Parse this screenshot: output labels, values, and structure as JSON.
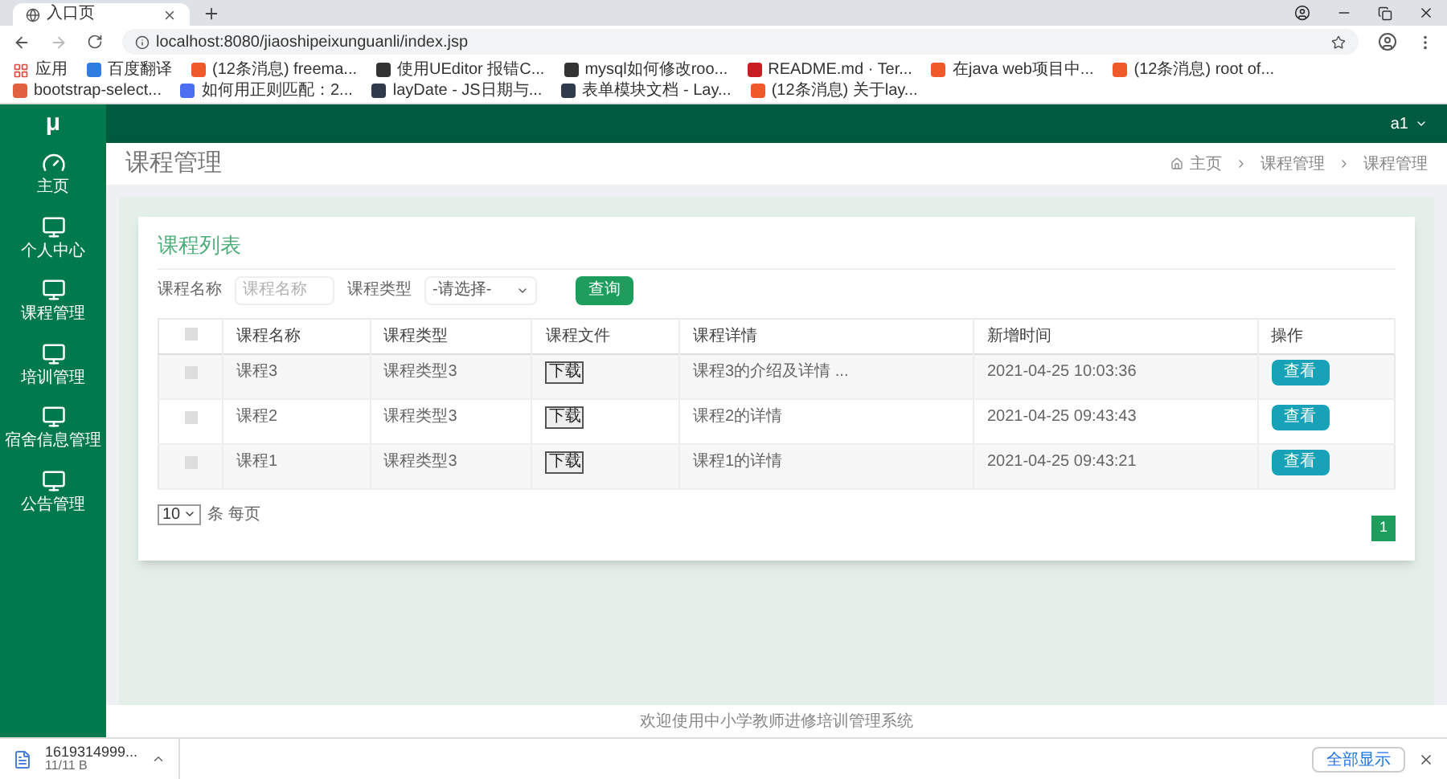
{
  "browser": {
    "tab": {
      "title": "入口页",
      "selected": true
    },
    "url": "localhost:8080/jiaoshipeixunguanli/index.jsp",
    "bookmarks": [
      {
        "label": "应用",
        "kind": "apps"
      },
      {
        "label": "百度翻译",
        "kind": "translate"
      },
      {
        "label": "(12条消息) freema...",
        "kind": "csdn"
      },
      {
        "label": "使用UEditor 报错C...",
        "kind": "github"
      },
      {
        "label": "mysql如何修改roo...",
        "kind": "github"
      },
      {
        "label": "README.md · Ter...",
        "kind": "gitee"
      },
      {
        "label": "在java web项目中...",
        "kind": "csdn"
      },
      {
        "label": "(12条消息) root of...",
        "kind": "csdn"
      },
      {
        "label": "bootstrap-select...",
        "kind": "page"
      },
      {
        "label": "如何用正则匹配：2...",
        "kind": "baidu"
      },
      {
        "label": "layDate - JS日期与...",
        "kind": "layui"
      },
      {
        "label": "表单模块文档 - Lay...",
        "kind": "layui"
      },
      {
        "label": "(12条消息) 关于lay...",
        "kind": "csdn"
      }
    ]
  },
  "app": {
    "logo": "μ",
    "user": "a1",
    "sidebar": {
      "items": [
        {
          "label": "主页",
          "kind": "dashboard",
          "selected": false
        },
        {
          "label": "个人中心",
          "kind": "monitor",
          "selected": false
        },
        {
          "label": "课程管理",
          "kind": "monitor",
          "selected": false
        },
        {
          "label": "培训管理",
          "kind": "monitor",
          "selected": false
        },
        {
          "label": "宿舍信息管理",
          "kind": "monitor",
          "selected": false
        },
        {
          "label": "公告管理",
          "kind": "monitor",
          "selected": false
        }
      ]
    },
    "page_title": "课程管理",
    "breadcrumb": [
      "主页",
      "课程管理",
      "课程管理"
    ],
    "card": {
      "title": "课程列表",
      "filters": {
        "name_label": "课程名称",
        "name_placeholder": "课程名称",
        "type_label": "课程类型",
        "type_value": "-请选择-",
        "search_button": "查询"
      },
      "table": {
        "header_checked": false,
        "columns": [
          "课程名称",
          "课程类型",
          "课程文件",
          "课程详情",
          "新增时间",
          "操作"
        ],
        "rows": [
          {
            "checked": false,
            "name": "课程3",
            "type": "课程类型3",
            "file": "下载",
            "detail": "课程3的介绍及详情 ...",
            "time": "2021-04-25 10:03:36",
            "action": "查看"
          },
          {
            "checked": false,
            "name": "课程2",
            "type": "课程类型3",
            "file": "下载",
            "detail": "课程2的详情",
            "time": "2021-04-25 09:43:43",
            "action": "查看"
          },
          {
            "checked": false,
            "name": "课程1",
            "type": "课程类型3",
            "file": "下载",
            "detail": "课程1的详情",
            "time": "2021-04-25 09:43:21",
            "action": "查看"
          }
        ]
      },
      "page_size": "10",
      "page_size_label": "条 每页",
      "pages": [
        {
          "label": "1",
          "selected": true
        }
      ]
    },
    "footer": "欢迎使用中小学教师进修培训管理系统"
  },
  "download_bar": {
    "file": "1619314999...",
    "size": "11/11 B",
    "show_all": "全部显示"
  }
}
